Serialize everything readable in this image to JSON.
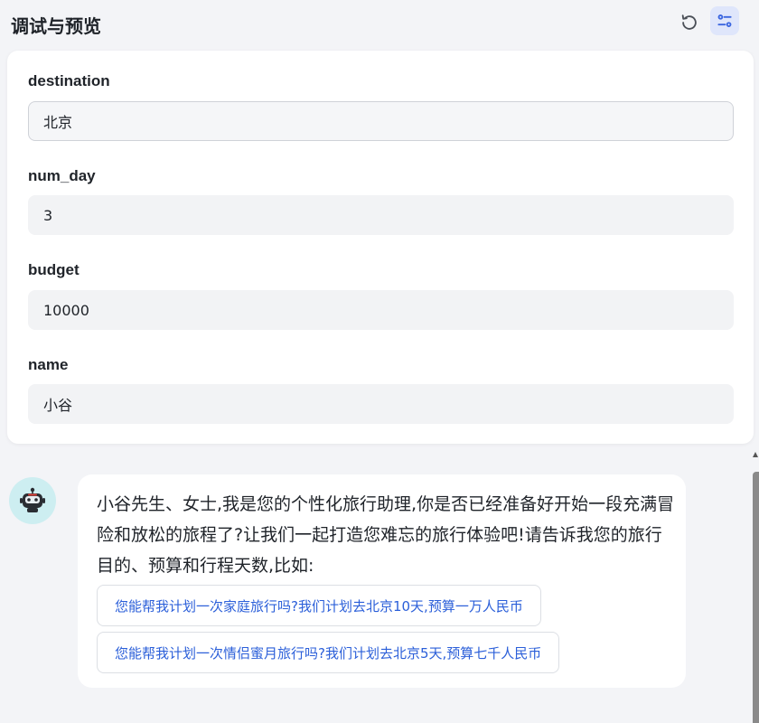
{
  "header": {
    "title": "调试与预览",
    "refresh_icon": "refresh-icon",
    "settings_icon": "settings-sliders-icon"
  },
  "form": {
    "fields": [
      {
        "label": "destination",
        "value": "北京"
      },
      {
        "label": "num_day",
        "value": "3"
      },
      {
        "label": "budget",
        "value": "10000"
      },
      {
        "label": "name",
        "value": "小谷"
      }
    ]
  },
  "chat": {
    "avatar_icon": "robot-avatar-icon",
    "message": "小谷先生、女士,我是您的个性化旅行助理,你是否已经准备好开始一段充满冒险和放松的旅程了?让我们一起打造您难忘的旅行体验吧!请告诉我您的旅行目的、预算和行程天数,比如:",
    "suggestions": [
      "您能帮我计划一次家庭旅行吗?我们计划去北京10天,预算一万人民币",
      "您能帮我计划一次情侣蜜月旅行吗?我们计划去北京5天,预算七千人民币"
    ]
  },
  "colors": {
    "accent": "#2b5fd9",
    "background": "#f3f4f7",
    "input_bg": "#f2f3f5",
    "avatar_bg": "#cdeef1"
  }
}
